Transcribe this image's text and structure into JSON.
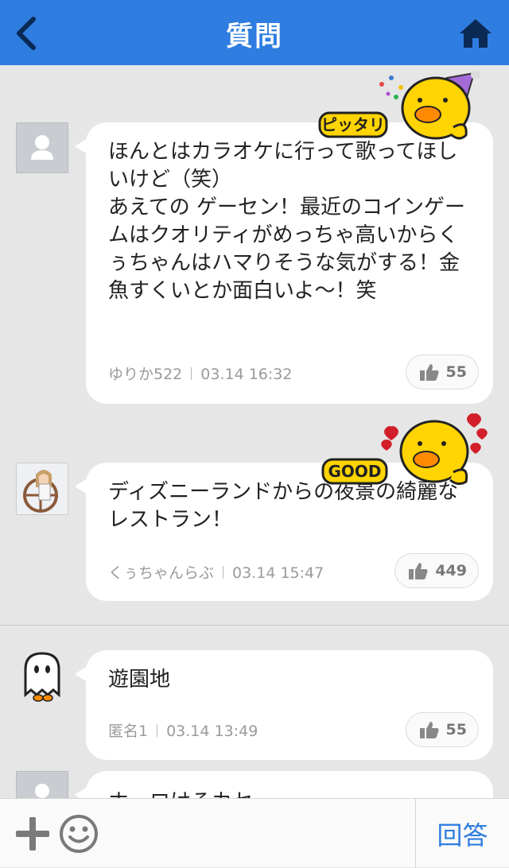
{
  "header": {
    "title": "質問"
  },
  "answers": [
    {
      "paragraphs": [
        "ほんとはカラオケに行って歌ってほしいけど（笑）",
        "あえての ゲーセン！最近のコインゲームはクオリティがめっちゃ高いからくぅちゃんはハマりそうな気がする！金魚すくいとか面白いよ〜！笑"
      ],
      "author": "ゆりか522",
      "date": "03.14 16:32",
      "likes": "55",
      "sticker_text": "ピッタリ"
    },
    {
      "paragraphs": [
        "ディズニーランドからの夜景の綺麗なレストラン！"
      ],
      "author": "くぅちゃんらぶ",
      "date": "03.14 15:47",
      "likes": "449",
      "sticker_text": "GOOD"
    },
    {
      "paragraphs": [
        "遊園地"
      ],
      "author": "匿名1",
      "date": "03.14 13:49",
      "likes": "55"
    },
    {
      "partial_text": "ホ…ロけるカセ"
    }
  ],
  "bottom_bar": {
    "answer_label": "回答"
  },
  "colors": {
    "accent": "#2f7de0",
    "background": "#e6e6e6"
  },
  "icons": [
    "back-chevron-icon",
    "home-icon",
    "person-placeholder-icon",
    "thumbs-up-icon",
    "plus-icon",
    "smiley-icon"
  ]
}
